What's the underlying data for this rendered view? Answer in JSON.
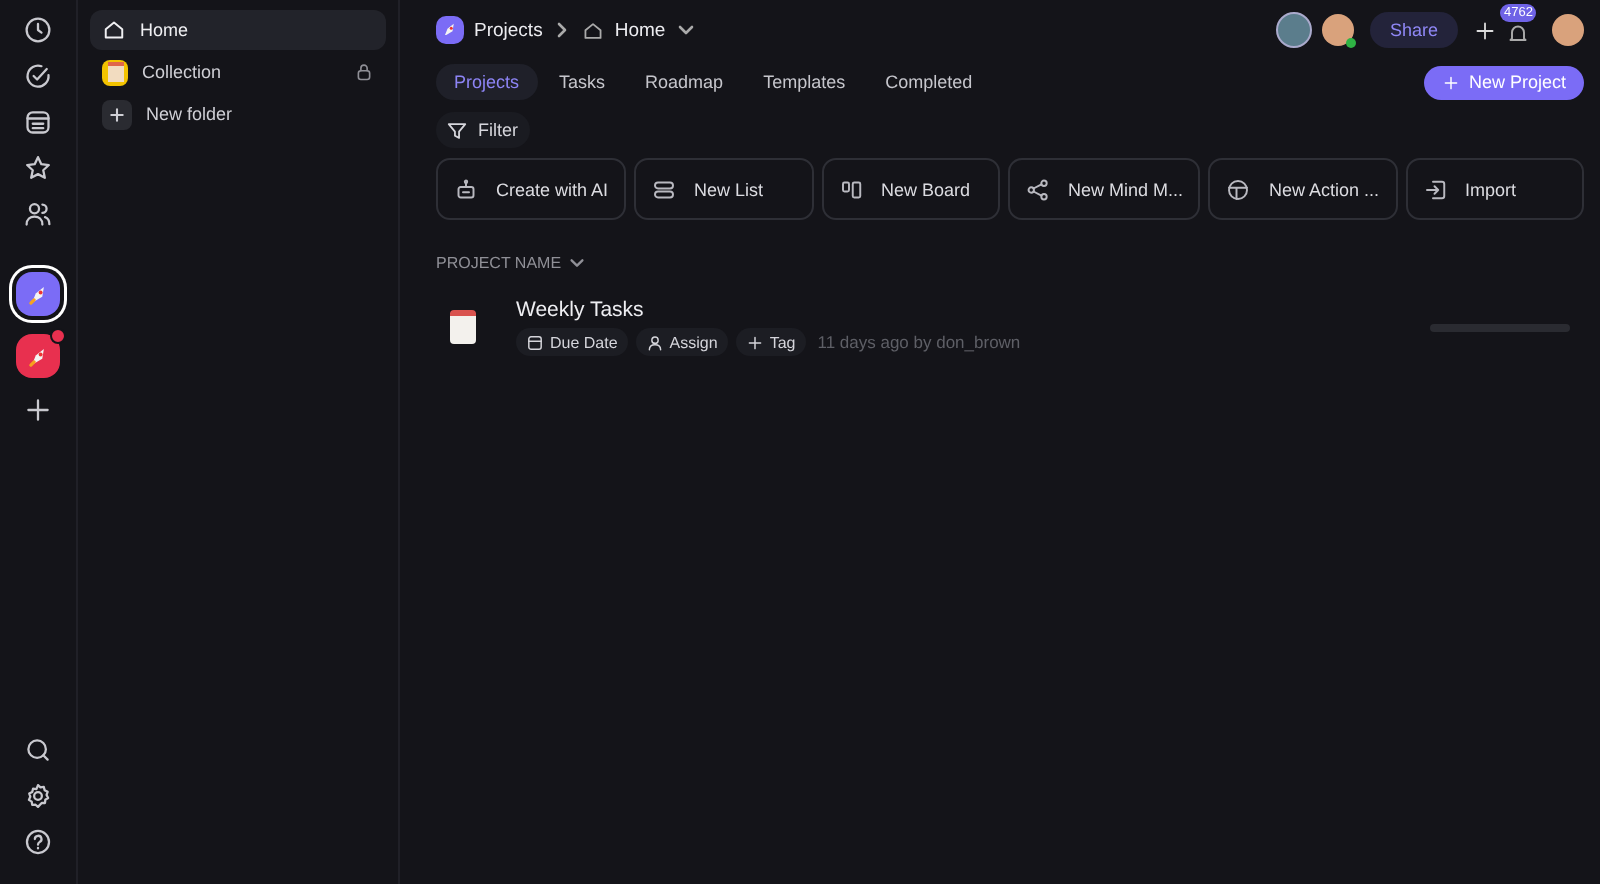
{
  "rail": {
    "workspaces": [
      {
        "selected": true,
        "color": "#7b6cf6",
        "unread": false
      },
      {
        "selected": false,
        "color": "#e8304f",
        "unread": true
      }
    ]
  },
  "sidebar": {
    "items": [
      {
        "kind": "home",
        "label": "Home",
        "selected": true
      },
      {
        "kind": "collection",
        "label": "Collection",
        "selected": false
      },
      {
        "kind": "add",
        "label": "New folder",
        "selected": false
      }
    ]
  },
  "breadcrumb": {
    "workspace": "Projects",
    "page": "Home"
  },
  "header": {
    "share": "Share",
    "notifications": "4762",
    "new_project": "New Project"
  },
  "tabs": [
    {
      "label": "Projects",
      "selected": true
    },
    {
      "label": "Tasks",
      "selected": false
    },
    {
      "label": "Roadmap",
      "selected": false
    },
    {
      "label": "Templates",
      "selected": false
    },
    {
      "label": "Completed",
      "selected": false
    }
  ],
  "filter": "Filter",
  "actions": [
    {
      "kind": "ai",
      "label": "Create with AI"
    },
    {
      "kind": "list",
      "label": "New List"
    },
    {
      "kind": "board",
      "label": "New Board"
    },
    {
      "kind": "mind",
      "label": "New Mind M..."
    },
    {
      "kind": "action",
      "label": "New Action ..."
    },
    {
      "kind": "import",
      "label": "Import"
    }
  ],
  "table": {
    "column": "PROJECT NAME",
    "rows": [
      {
        "title": "Weekly Tasks",
        "due": "Due Date",
        "assign": "Assign",
        "tag": "Tag",
        "meta": "11 days ago by don_brown",
        "level": 0
      }
    ]
  }
}
